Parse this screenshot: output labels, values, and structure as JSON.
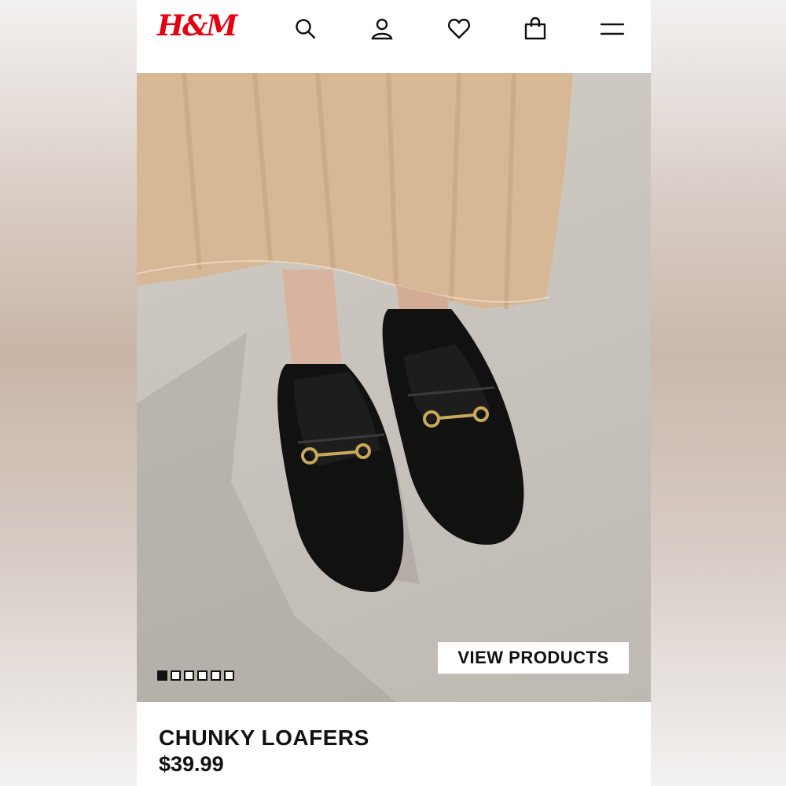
{
  "brand": {
    "logo_text": "H&M",
    "logo_color": "#e50010"
  },
  "header": {
    "icons": [
      "search-icon",
      "account-icon",
      "heart-icon",
      "shopping-bag-icon",
      "menu-icon"
    ]
  },
  "hero": {
    "cta_label": "VIEW PRODUCTS",
    "carousel": {
      "total": 6,
      "active_index": 0
    }
  },
  "product": {
    "name": "CHUNKY LOAFERS",
    "price": "$39.99"
  }
}
